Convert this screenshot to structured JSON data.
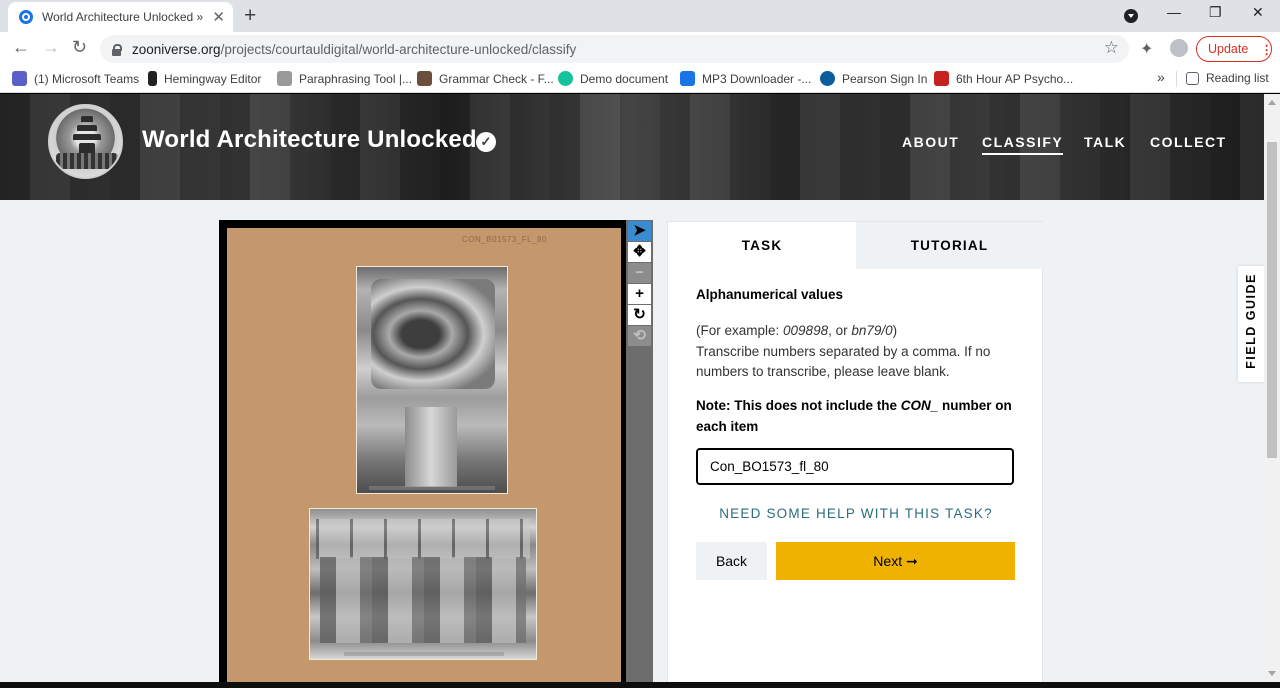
{
  "browser": {
    "tab_title": "World Architecture Unlocked » C",
    "tab_close": "✕",
    "new_tab": "+",
    "url_host": "zooniverse.org",
    "url_path": "/projects/courtauldigital/world-architecture-unlocked/classify",
    "update_label": "Update",
    "update_dots": "⋮",
    "win_min": "—",
    "win_restore": "❐",
    "win_close": "✕",
    "back": "←",
    "forward": "→",
    "reload": "↻",
    "star": "☆",
    "extensions": "✦",
    "bookmarks": [
      {
        "label": "(1) Microsoft Teams",
        "color": "#5b5fc7"
      },
      {
        "label": "Hemingway Editor",
        "color": "#222222"
      },
      {
        "label": "Paraphrasing Tool |...",
        "color": "#777777"
      },
      {
        "label": "Grammar Check - F...",
        "color": "#6b4e3d"
      },
      {
        "label": "Demo document",
        "color": "#15c39a"
      },
      {
        "label": "MP3 Downloader -...",
        "color": "#1a73e8"
      },
      {
        "label": "Pearson Sign In",
        "color": "#0b5e9b"
      },
      {
        "label": "6th Hour AP Psycho...",
        "color": "#c5221f"
      }
    ],
    "bookmarks_more": "»",
    "reading_list": "Reading list"
  },
  "project": {
    "title": "World Architecture Unlocked",
    "verified_mark": "✓",
    "nav": [
      "ABOUT",
      "CLASSIFY",
      "TALK",
      "COLLECT"
    ],
    "active_nav": "CLASSIFY"
  },
  "viewer": {
    "reference_text": "CON_B01573_FL_80",
    "tools": [
      "cursor-icon",
      "move-icon",
      "zoom-out-icon",
      "zoom-in-icon",
      "rotate-icon",
      "reset-icon"
    ],
    "tool_glyphs": [
      "➤",
      "✥",
      "−",
      "+",
      "↻",
      "⟲"
    ]
  },
  "task": {
    "tab_task": "TASK",
    "tab_tutorial": "TUTORIAL",
    "question_title": "Alphanumerical values",
    "help_prefix": "(For example: ",
    "example1": "009898",
    "help_mid": ", or ",
    "example2": "bn79/0",
    "help_suffix": ")",
    "help_body": "Transcribe numbers separated by a comma. If no numbers to transcribe, please leave blank.",
    "note_prefix": "Note: This does not include the ",
    "note_con": "CON_",
    "note_suffix": " number on each item",
    "answer_value": "Con_BO1573_fl_80",
    "help_link": "NEED SOME HELP WITH THIS TASK?",
    "back_label": "Back",
    "next_label": "Next ➞"
  },
  "field_guide": "FIELD GUIDE"
}
